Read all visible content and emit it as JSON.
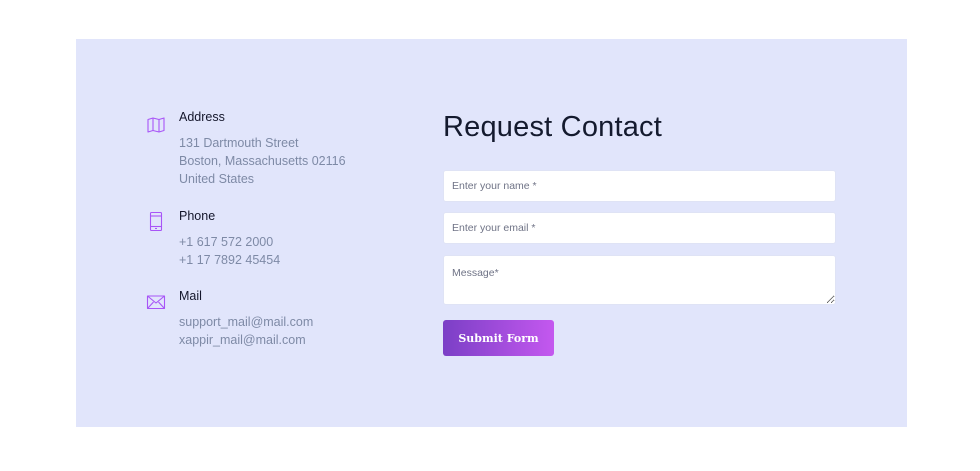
{
  "contact_info": {
    "address": {
      "icon": "map-icon",
      "title": "Address",
      "lines": [
        "131 Dartmouth Street",
        "Boston, Massachusetts 02116",
        "United States"
      ]
    },
    "phone": {
      "icon": "phone-icon",
      "title": "Phone",
      "lines": [
        "+1 617 572 2000",
        "+1 17 7892 45454"
      ]
    },
    "mail": {
      "icon": "mail-icon",
      "title": "Mail",
      "lines": [
        "support_mail@mail.com",
        "xappir_mail@mail.com"
      ]
    }
  },
  "form": {
    "title": "Request Contact",
    "name_placeholder": "Enter your name *",
    "email_placeholder": "Enter your email *",
    "message_placeholder": "Message*",
    "submit_label": "Submit Form"
  },
  "colors": {
    "panel_background": "#e1e5fb",
    "icon_accent": "#a855f7",
    "button_gradient_start": "#7b3fc6",
    "button_gradient_end": "#c458ef"
  }
}
